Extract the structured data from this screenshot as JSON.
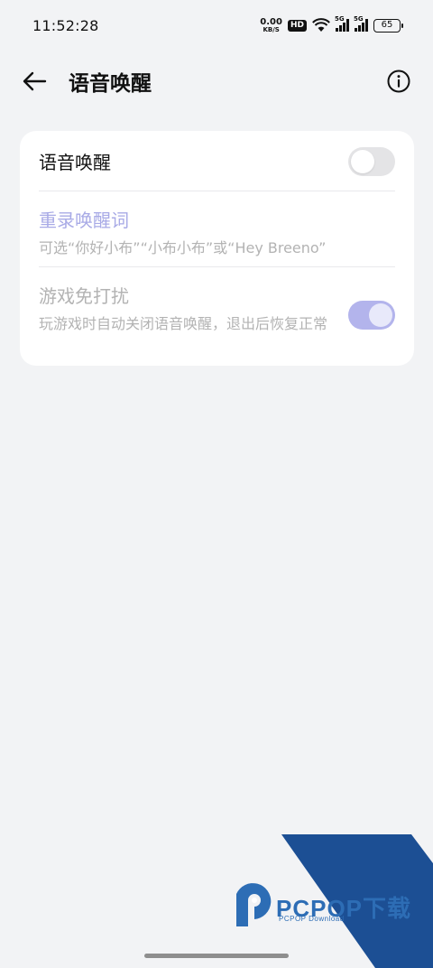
{
  "status_bar": {
    "time": "11:52:28",
    "net_speed_value": "0.00",
    "net_speed_unit": "KB/S",
    "hd_badge": "HD",
    "signal1_label": "5G",
    "signal2_label": "5G",
    "battery": "65"
  },
  "header": {
    "title": "语音唤醒",
    "back_icon": "arrow-left-icon",
    "info_icon": "info-icon"
  },
  "settings": {
    "voice_wakeup": {
      "title": "语音唤醒",
      "enabled": false
    },
    "rerecord": {
      "title": "重录唤醒词",
      "subtitle": "可选“你好小布”“小布小布”或“Hey Breeno”"
    },
    "game_mode": {
      "title": "游戏免打扰",
      "subtitle": "玩游戏时自动关闭语音唤醒，退出后恢复正常",
      "enabled": true
    }
  },
  "watermark": {
    "brand": "PCPOP下载",
    "sub": "PCPOP Download"
  },
  "colors": {
    "accent": "#a8aae6",
    "toggle_on": "#b3b4ec",
    "watermark_blue": "#2d6db5",
    "watermark_dark": "#1c4f94"
  }
}
